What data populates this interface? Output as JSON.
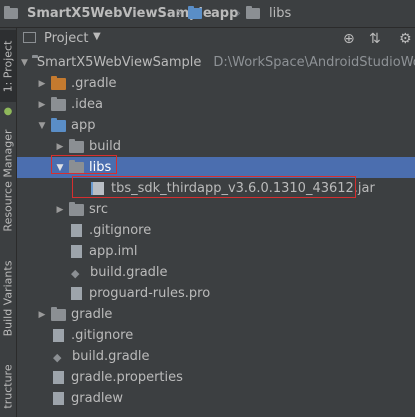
{
  "breadcrumb": {
    "items": [
      {
        "label": "SmartX5WebViewSample",
        "icon": "project-folder-icon"
      },
      {
        "label": "app",
        "icon": "module-folder-icon"
      },
      {
        "label": "libs",
        "icon": "folder-icon"
      }
    ]
  },
  "side_strip": {
    "project_tab": "1: Project",
    "resource_manager_tab": "Resource Manager",
    "build_variants_tab": "Build Variants",
    "structure_tab": "tructure"
  },
  "project_panel": {
    "title": "Project",
    "dropdown_icon": "chevron-down-icon"
  },
  "tree": {
    "root": {
      "label": "SmartX5WebViewSample",
      "path": "D:\\WorkSpace\\AndroidStudioWork"
    },
    "items": [
      {
        "label": ".gradle"
      },
      {
        "label": ".idea"
      },
      {
        "label": "app"
      },
      {
        "label": "build"
      },
      {
        "label": "libs"
      },
      {
        "label": "tbs_sdk_thirdapp_v3.6.0.1310_43612.jar"
      },
      {
        "label": "src"
      },
      {
        "label": ".gitignore"
      },
      {
        "label": "app.iml"
      },
      {
        "label": "build.gradle"
      },
      {
        "label": "proguard-rules.pro"
      },
      {
        "label": "gradle"
      },
      {
        "label": ".gitignore"
      },
      {
        "label": "build.gradle"
      },
      {
        "label": "gradle.properties"
      },
      {
        "label": "gradlew"
      }
    ]
  },
  "colors": {
    "background": "#3c3f41",
    "selection": "#4b6eaf",
    "highlight_box": "#d62f2f",
    "orange_folder": "#c47a2f"
  }
}
